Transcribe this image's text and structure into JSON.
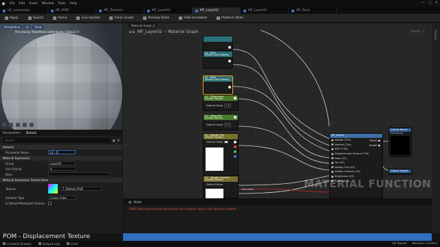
{
  "menu": [
    "File",
    "Edit",
    "Asset",
    "Window",
    "Tools",
    "Help"
  ],
  "tabs": [
    {
      "label": "UE_Landscape",
      "active": false
    },
    {
      "label": "MF_POM",
      "active": false
    },
    {
      "label": "MF_Textures",
      "active": false
    },
    {
      "label": "MF_Layer01",
      "active": false
    },
    {
      "label": "MF_Layer02",
      "active": true
    },
    {
      "label": "MF_Layer02",
      "active": false
    },
    {
      "label": "MF_Rock",
      "active": false
    }
  ],
  "toolbar": [
    "Apply",
    "Search",
    "Home",
    "Live Update",
    "Clean Graph",
    "Preview State",
    "Hide Unrelated",
    "Stats",
    "Platform Stats"
  ],
  "viewport": {
    "tabs": [
      "Perspective",
      "Lit",
      "Show"
    ],
    "preview_text": "Previewing: MakeMaterialAttributes (Output) 0"
  },
  "details": {
    "tabs": [
      "Parameters",
      "Details"
    ],
    "search_placeholder": "Search",
    "sections": [
      "General",
      "Material Expression",
      "Material Expression Texture Base"
    ],
    "parameter_name_label": "Parameter Name",
    "parameter_name_value": "L2 - D",
    "group_label": "Group",
    "group_value": "Layer02",
    "sort_priority_label": "Sort Priority",
    "sort_priority_value": "0",
    "desc_label": "Desc",
    "texture_label": "Texture",
    "texture_value": "T_Default_RGB",
    "sampler_label": "Sampler Type",
    "sampler_value": "Linear Color",
    "default_meshpaint_label": "Is Default Meshpaint Texture"
  },
  "graph": {
    "tab": "Material Graph_0",
    "breadcrumb": [
      "MF_Layer02",
      "Material Graph"
    ],
    "zoom": "Zoom -1",
    "watermark": "MATERIAL FUNCTION",
    "nodes": {
      "n1_title": "L2 - RDO",
      "n1_sub": "(Param Def Albedo)",
      "n2_title": "L2 - RDO",
      "n2_sub": "(Param Def Albedo)",
      "n3_title": "L2 - Tiling Near",
      "n3_sub": "(Scalar Param)",
      "n3_label": "Default Value",
      "n3_value": "1.0",
      "n4_title": "L2 - Tiling Far",
      "n4_sub": "(Scalar Param)",
      "n4_label": "Default Value",
      "n4_value": "5.0",
      "n5_title": "L2 - Albedo Tint",
      "n5_sub": "(Vector Param)",
      "n5_label": "Default Value",
      "n6_title": "L2 - Albedo Controls",
      "n6_sub": "(Vector Param)",
      "n6_label": "Default Value",
      "n6_pin": "Saturation",
      "mf_title": "MF_Layers",
      "mf_inputs": [
        "Albedo (T2d)",
        "Normal (T2d)",
        "RDO (T2d)",
        "Displacement Texture (T2d)",
        "Near (V2)",
        "Far (V2)",
        "Albedo Tint (V3)",
        "Albedo Controls (V3)",
        "Brightness (V3)",
        "Contrast (S)"
      ],
      "mf_outputs": [
        "Result",
        "Height"
      ],
      "out1_title": "Output Result",
      "out1_pin": "Processing",
      "out2_title": "Output Height"
    }
  },
  "stats": {
    "tab": "Stats",
    "message": "[SM6] Missing Preview connection for function input 'Use Distance Blend'"
  },
  "rightbar": "Palette",
  "lecture_title": "POM - Displacement Texture",
  "statusbar": [
    "Content Drawer",
    "Output Log",
    "Cmd"
  ],
  "statusbar_right": [
    "All Saved",
    "Revision Control"
  ]
}
